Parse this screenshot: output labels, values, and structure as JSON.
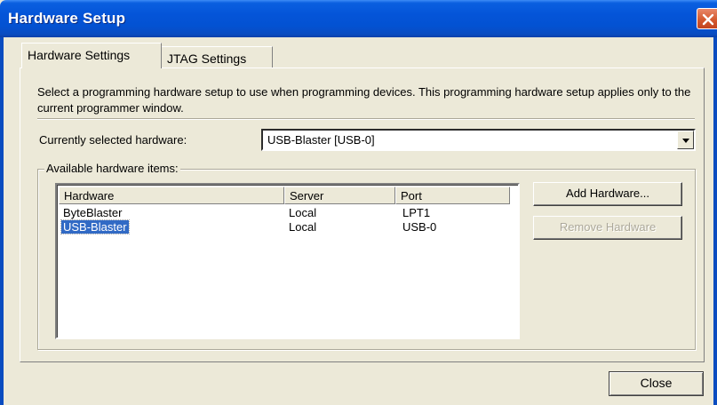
{
  "window": {
    "title": "Hardware Setup"
  },
  "tabs": [
    {
      "label": "Hardware Settings",
      "active": true
    },
    {
      "label": "JTAG Settings",
      "active": false
    }
  ],
  "hardware_settings": {
    "description": "Select a programming hardware setup to use when programming devices. This programming hardware setup applies only to the current programmer window.",
    "currently_selected_label": "Currently selected hardware:",
    "currently_selected_value": "USB-Blaster [USB-0]",
    "available_group_label": "Available hardware items:",
    "table": {
      "columns": [
        "Hardware",
        "Server",
        "Port"
      ],
      "rows": [
        {
          "hardware": "ByteBlaster",
          "server": "Local",
          "port": "LPT1",
          "selected": false
        },
        {
          "hardware": "USB-Blaster",
          "server": "Local",
          "port": "USB-0",
          "selected": true
        }
      ]
    },
    "add_button_label": "Add Hardware...",
    "remove_button_label": "Remove Hardware",
    "remove_button_enabled": false
  },
  "footer": {
    "close_label": "Close"
  },
  "colors": {
    "titlebar": "#0454d8",
    "selection": "#316ac5",
    "dialog_bg": "#ece9d8"
  }
}
